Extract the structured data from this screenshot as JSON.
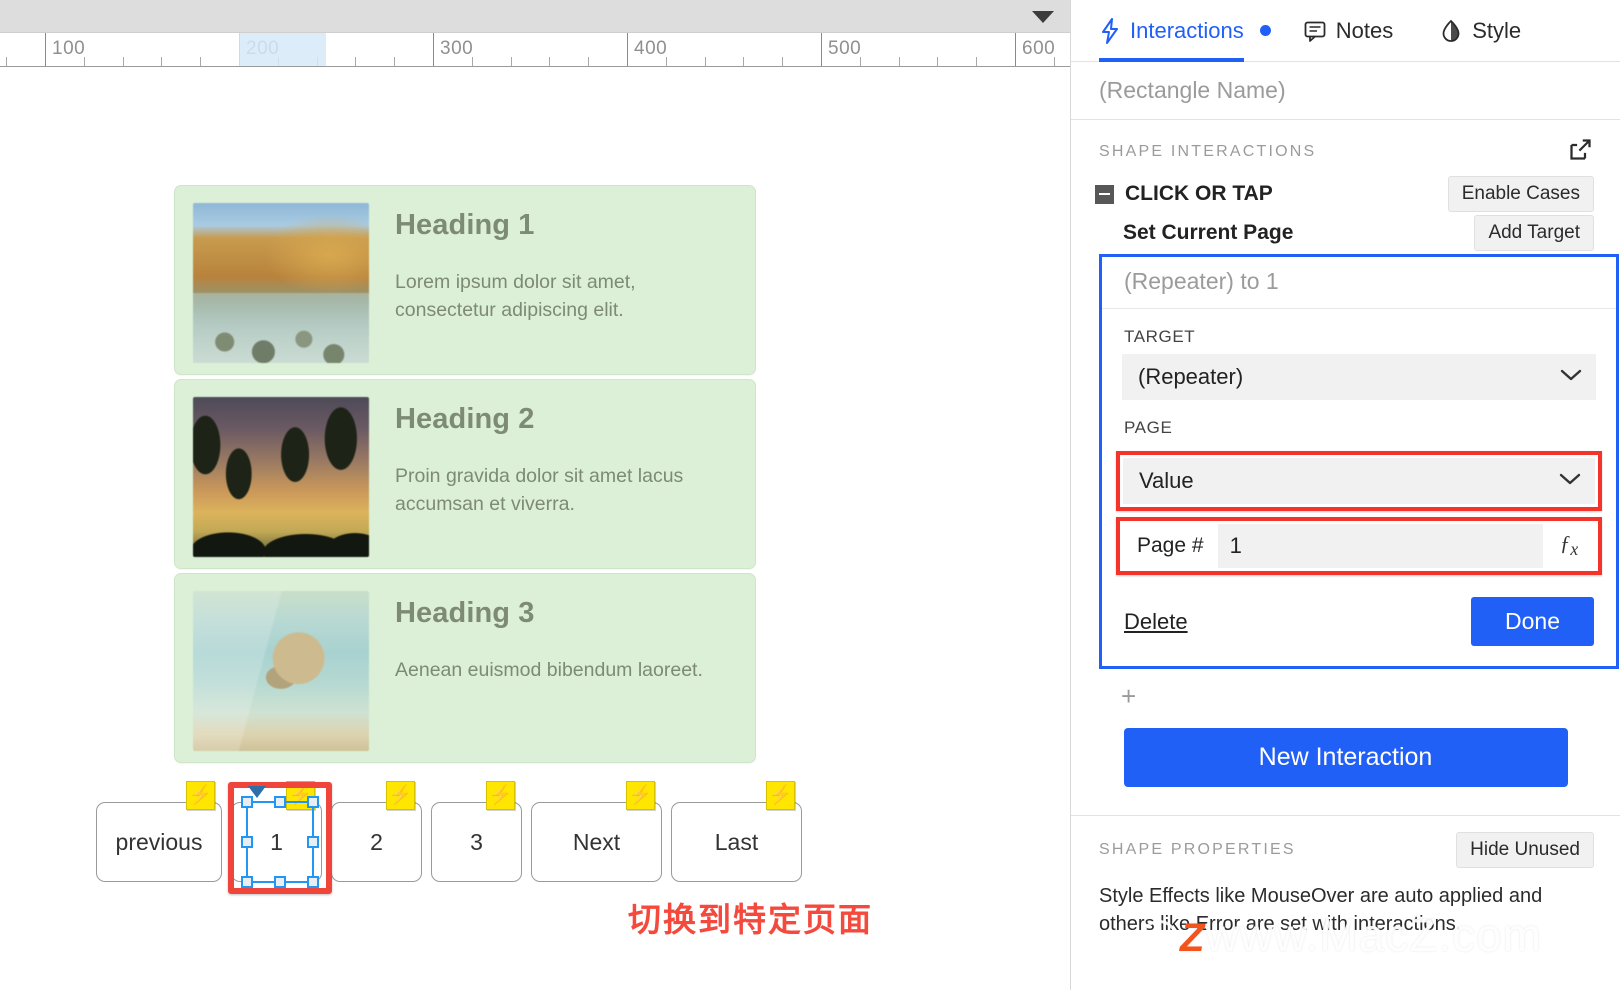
{
  "canvas": {
    "ruler": {
      "labels": [
        "100",
        "200",
        "300",
        "400",
        "500",
        "600"
      ],
      "highlight_label": "200"
    },
    "cards": [
      {
        "heading": "Heading 1",
        "text": "Lorem ipsum dolor sit amet, consectetur adipiscing elit.",
        "image": "coastal-cliff-photo"
      },
      {
        "heading": "Heading 2",
        "text": "Proin gravida dolor sit amet lacus accumsan et viverra.",
        "image": "palm-sunset-photo"
      },
      {
        "heading": "Heading 3",
        "text": "Aenean euismod bibendum laoreet.",
        "image": "beach-rock-photo"
      }
    ],
    "pager": [
      {
        "label": "previous",
        "width": "w-prev",
        "selected": false
      },
      {
        "label": "1",
        "width": "w-num",
        "selected": true
      },
      {
        "label": "2",
        "width": "w-num",
        "selected": false
      },
      {
        "label": "3",
        "width": "w-num",
        "selected": false
      },
      {
        "label": "Next",
        "width": "w-wide",
        "selected": false
      },
      {
        "label": "Last",
        "width": "w-wide",
        "selected": false
      }
    ],
    "annotation": "切换到特定页面"
  },
  "panel": {
    "tabs": [
      {
        "label": "Interactions",
        "icon": "lightning-icon",
        "active": true,
        "badge": true
      },
      {
        "label": "Notes",
        "icon": "comment-icon",
        "active": false,
        "badge": false
      },
      {
        "label": "Style",
        "icon": "contrast-drop-icon",
        "active": false,
        "badge": false
      }
    ],
    "name_placeholder": "(Rectangle Name)",
    "shape_interactions": {
      "title": "SHAPE INTERACTIONS",
      "popout_icon": "external-link-icon",
      "event": "CLICK OR TAP",
      "enable_cases": "Enable Cases",
      "action": "Set Current Page",
      "add_target": "Add Target"
    },
    "editor": {
      "summary": "(Repeater) to 1",
      "target_label": "TARGET",
      "target_value": "(Repeater)",
      "page_label": "PAGE",
      "page_value": "Value",
      "pagenum_label": "Page #",
      "pagenum_value": "1",
      "fx_icon": "fx-icon",
      "delete": "Delete",
      "done": "Done"
    },
    "add_case": "+",
    "new_interaction": "New Interaction",
    "shape_properties": {
      "title": "SHAPE PROPERTIES",
      "hide_unused": "Hide Unused",
      "description": "Style Effects like MouseOver are auto applied and others like Error are set with interactions."
    },
    "watermark": "www.MacZ.com"
  },
  "colors": {
    "accent_blue": "#2160f6",
    "highlight_red": "#f4342a",
    "bolt_yellow": "#ffe600",
    "card_green": "#dcf0d7",
    "annotation_red": "#f4493c"
  }
}
